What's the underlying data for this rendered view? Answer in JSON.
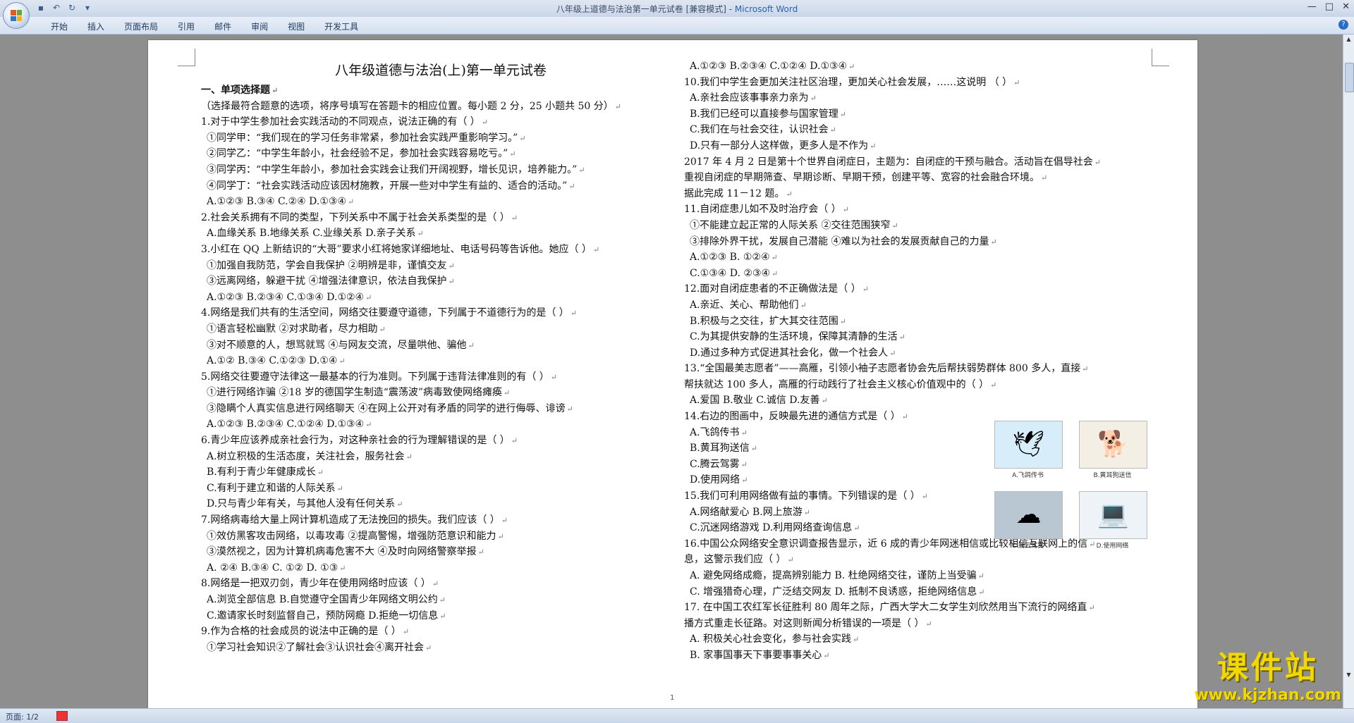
{
  "window": {
    "title": "八年级上道德与法治第一单元试卷 [兼容模式] - ",
    "app_name": "Microsoft Word",
    "controls": [
      "—",
      "□",
      "✕"
    ]
  },
  "ribbon": {
    "tabs": [
      "开始",
      "插入",
      "页面布局",
      "引用",
      "邮件",
      "审阅",
      "视图",
      "开发工具"
    ]
  },
  "document": {
    "title": "八年级道德与法治(上)第一单元试卷",
    "left_lines": [
      "一、单项选择题",
      "（选择最符合题意的选项，将序号填写在答题卡的相应位置。每小题 2 分，25 小题共 50 分）",
      "1.对于中学生参加社会实践活动的不同观点，说法正确的有（     ）",
      "①同学甲：“我们现在的学习任务非常紧，参加社会实践严重影响学习。”",
      "②同学乙：“中学生年龄小，社会经验不足，参加社会实践容易吃亏。”",
      "③同学丙：“中学生年龄小，参加社会实践会让我们开阔视野，增长见识，培养能力。”",
      "④同学丁：“社会实践活动应该因材施教，开展一些对中学生有益的、适合的活动。”",
      "A.①②③        B.③④        C.②④        D.①③④",
      "2.社会关系拥有不同的类型，下列关系中不属于社会关系类型的是（     ）",
      "A.血缘关系        B.地缘关系        C.业缘关系        D.亲子关系",
      "3.小红在 QQ 上新结识的“大哥”要求小红将她家详细地址、电话号码等告诉他。她应（     ）",
      "①加强自我防范，学会自我保护   ②明辨是非，谨慎交友",
      "③远离网络，躲避干扰      ④增强法律意识，依法自我保护",
      "A.①②③        B.②③④        C.①③④        D.①②④",
      "4.网络是我们共有的生活空间，网络交往要遵守道德，下列属于不道德行为的是（     ）",
      "①语言轻松幽默        ②对求助者，尽力相助",
      "③对不顺意的人，想骂就骂     ④与网友交流，尽量哄他、骗他",
      "A.①②          B.③④        C.①②③          D.①④",
      "5.网络交往要遵守法律这一最基本的行为准则。下列属于违背法律准则的有（     ）",
      "①进行网络诈骗  ②18 岁的德国学生制造“震荡波”病毒致使网络瘫痪",
      "③隐瞒个人真实信息进行网络聊天  ④在网上公开对有矛盾的同学的进行侮辱、诽谤",
      "A.①②③       B.②③④        C.①②④        D.①③④",
      "6.青少年应该养成亲社会行为，对这种亲社会的行为理解错误的是（     ）",
      "A.树立积极的生活态度，关注社会，服务社会",
      "B.有利于青少年健康成长",
      "C.有利于建立和谐的人际关系",
      "D.只与青少年有关，与其他人没有任何关系",
      "7.网络病毒给大量上网计算机造成了无法挽回的损失。我们应该（     ）",
      "①效仿黑客攻击网络，以毒攻毒        ②提高警惕，增强防范意识和能力",
      "③漠然视之，因为计算机病毒危害不大     ④及时向网络警察举报",
      "A.  ②④          B.③④        C.  ①②          D.  ①③",
      "8.网络是一把双刃剑，青少年在使用网络时应该（     ）",
      "A.浏览全部信息          B.自觉遵守全国青少年网络文明公约",
      "C.邀请家长时刻监督自己，预防网瘾        D.拒绝一切信息",
      "9.作为合格的社会成员的说法中正确的是（     ）",
      "①学习社会知识②了解社会③认识社会④离开社会"
    ],
    "right_lines": [
      "A.①②③          B.②③④          C.①②④          D.①③④",
      "10.我们中学生会更加关注社区治理，更加关心社会发展，……这说明    （   ）",
      "A.亲社会应该事事亲力亲为",
      "B.我们已经可以直接参与国家管理",
      "C.我们在与社会交往，认识社会",
      "D.只有一部分人这样做，更多人是不作为",
      "2017 年 4 月 2 日是第十个世界自闭症日，主题为：自闭症的干预与融合。活动旨在倡导社会",
      "重视自闭症的早期筛查、早期诊断、早期干预，创建平等、宽容的社会融合环境。",
      "据此完成 11－12 题。",
      "11.自闭症患儿如不及时治疗会（     ）",
      "①不能建立起正常的人际关系     ②交往范围狭窄",
      "③排除外界干扰，发展自己潜能   ④难以为社会的发展贡献自己的力量",
      "A.①②③                         B.  ①②④",
      "C.①③④                         D.  ②③④",
      "12.面对自闭症患者的不正确做法是（     ）",
      "A.亲近、关心、帮助他们",
      "B.积极与之交往，扩大其交往范围",
      "C.为其提供安静的生活环境，保障其清静的生活",
      "D.通过多种方式促进其社会化，做一个社会人",
      "13.“全国最美志愿者”——高雁，引领小袖子志愿者协会先后帮扶弱势群体 800 多人，直接",
      "帮扶就达 100 多人，高雁的行动践行了社会主义核心价值观中的（     ）",
      "A.爱国              B.敬业              C.诚信              D.友善",
      "14.右边的图画中，反映最先进的通信方式是（     ）",
      "A.飞鸽传书",
      "B.黄耳狗送信",
      "C.腾云驾雾",
      "D.使用网络",
      "15.我们可利用网络做有益的事情。下列错误的是（     ）",
      "A.网络献爱心        B.网上旅游",
      "C.沉迷网络游戏      D.利用网络查询信息",
      "16.中国公众网络安全意识调查报告显示，近 6 成的青少年网迷相信或比较相信互联网上的信",
      "息，这警示我们应（   ）",
      "A.  避免网络成瘾，提高辨别能力   B.  杜绝网络交往，谨防上当受骗",
      "C.  增强猎奇心理，广泛结交网友   D.  抵制不良诱惑，拒绝网络信息",
      "17.  在中国工农红军长征胜利 80 周年之际，广西大学大二女学生刘欣然用当下流行的网络直",
      "播方式重走长征路。对这则新闻分析错误的一项是（     ）",
      "A.  积极关心社会变化，参与社会实践",
      "B.  家事国事天下事要事事关心"
    ],
    "figures": [
      {
        "caption": "A.飞鸽传书",
        "icon": "dove-icon"
      },
      {
        "caption": "B.黄耳狗送信",
        "icon": "dog-icon"
      },
      {
        "caption": "C.腾云驾雾",
        "icon": "cloud-icon"
      },
      {
        "caption": "D.使用网络",
        "icon": "computer-icon"
      }
    ],
    "page_number": "1"
  },
  "status": {
    "pages": "页面: 1/2"
  },
  "watermark": {
    "title": "课件站",
    "url": "www.kjzhan.com"
  },
  "colors": {
    "title_bar": "#dfe7f2",
    "app_name": "#2b62b0",
    "watermark": "#f0d800",
    "workspace": "#8e8e8e"
  }
}
